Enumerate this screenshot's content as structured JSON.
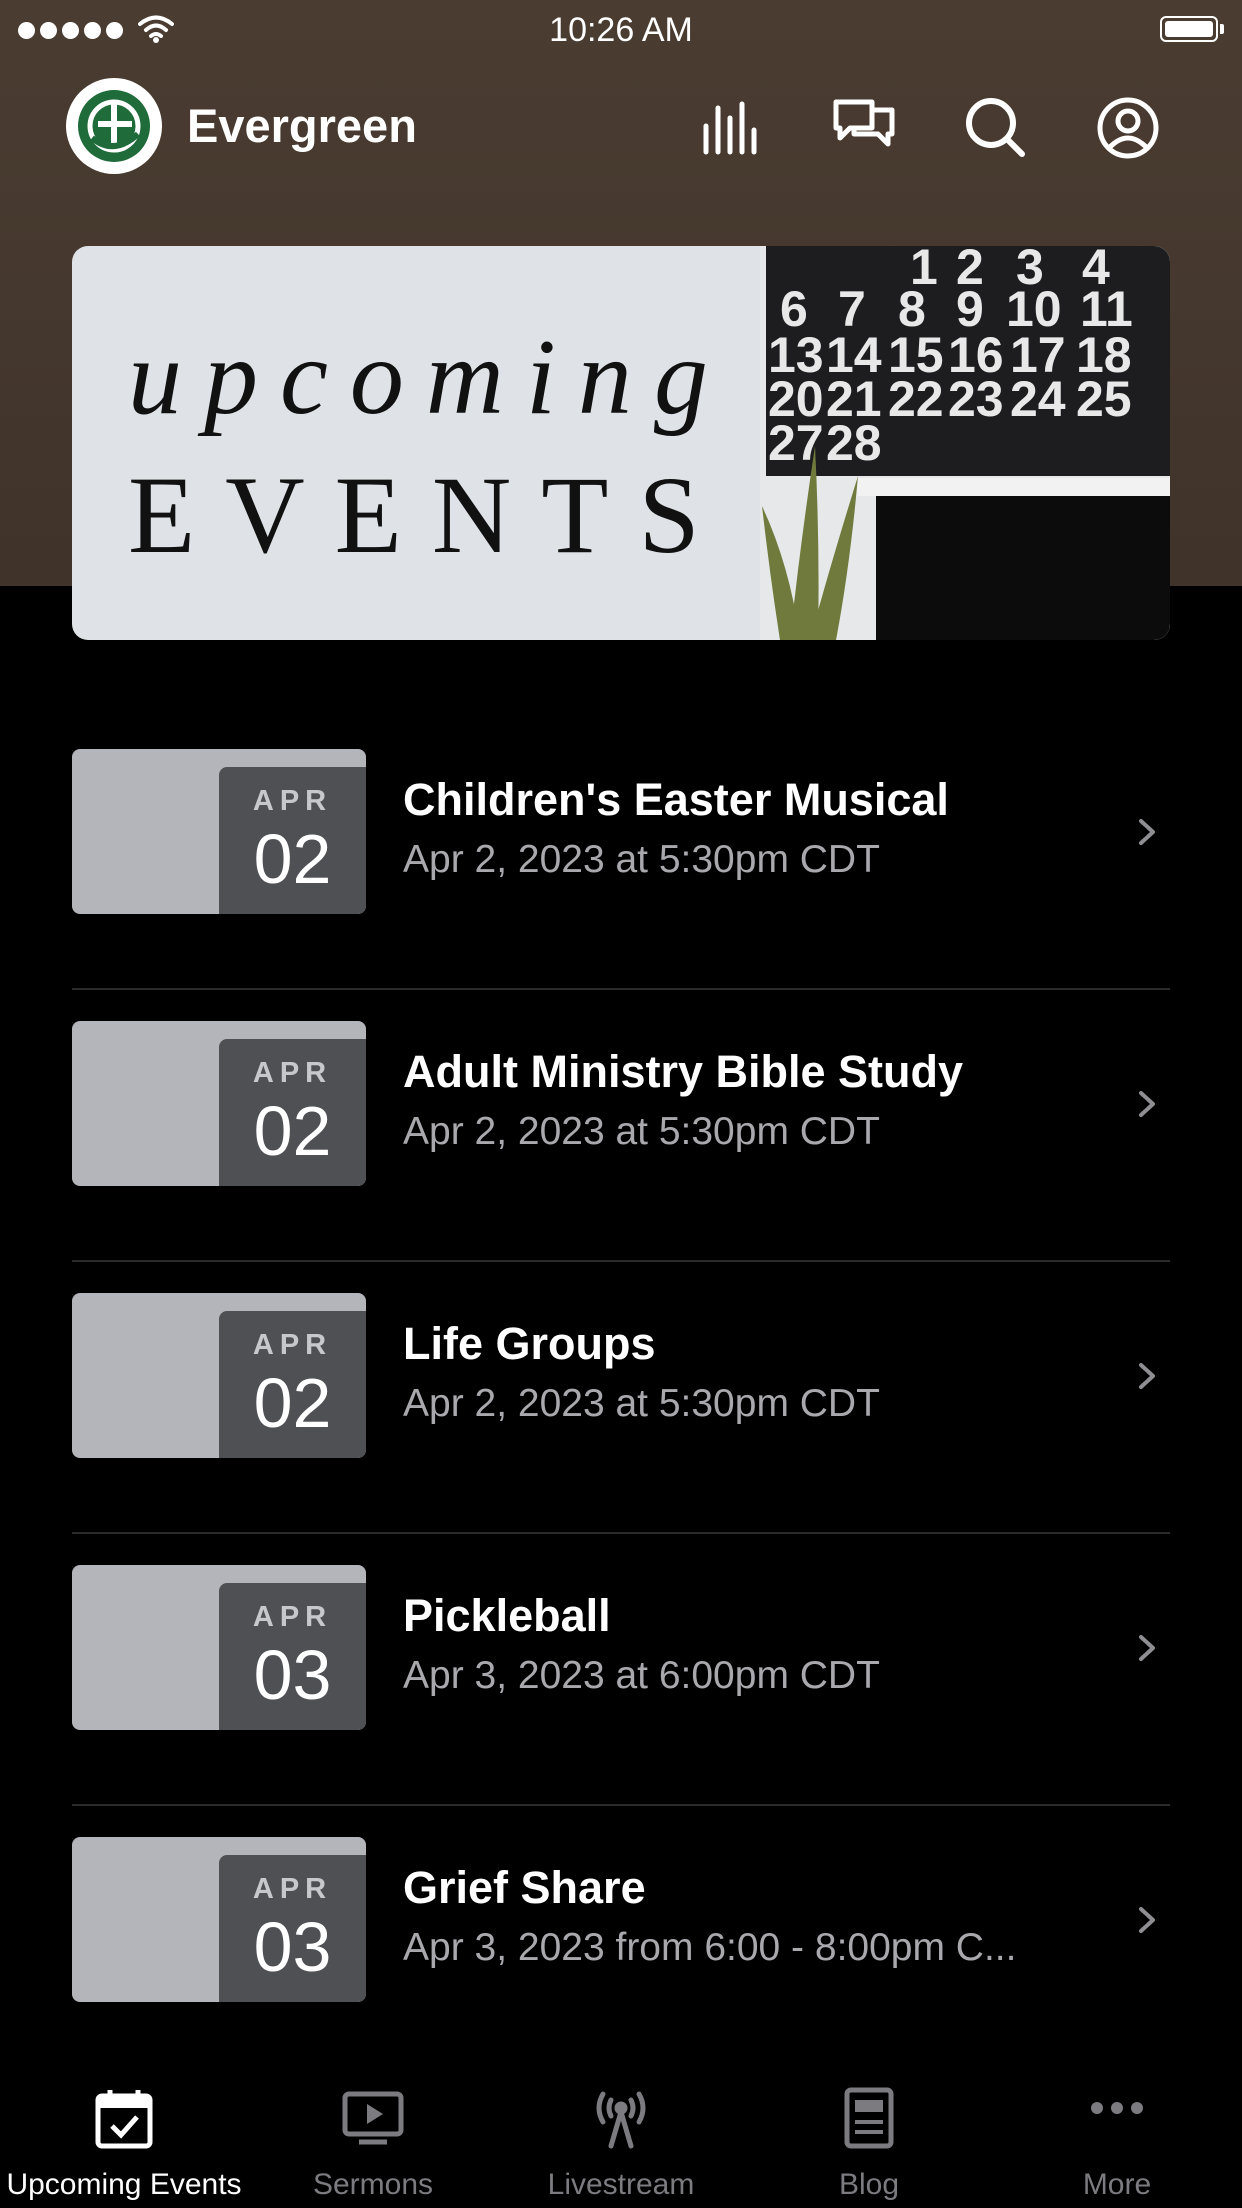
{
  "status_bar": {
    "time": "10:26 AM"
  },
  "app": {
    "title": "Evergreen"
  },
  "banner": {
    "line1": "upcoming",
    "line2": "EVENTS"
  },
  "events": [
    {
      "month": "APR",
      "day": "02",
      "title": "Children's Easter Musical",
      "when": "Apr 2, 2023 at 5:30pm CDT"
    },
    {
      "month": "APR",
      "day": "02",
      "title": "Adult Ministry Bible Study",
      "when": "Apr 2, 2023 at 5:30pm CDT"
    },
    {
      "month": "APR",
      "day": "02",
      "title": "Life Groups",
      "when": "Apr 2, 2023 at 5:30pm CDT"
    },
    {
      "month": "APR",
      "day": "03",
      "title": "Pickleball",
      "when": "Apr 3, 2023 at 6:00pm CDT"
    },
    {
      "month": "APR",
      "day": "03",
      "title": "Grief Share",
      "when": "Apr 3, 2023 from 6:00 - 8:00pm C..."
    }
  ],
  "tabs": [
    {
      "label": "Upcoming Events",
      "icon": "calendar-check-icon",
      "active": true
    },
    {
      "label": "Sermons",
      "icon": "play-screen-icon",
      "active": false
    },
    {
      "label": "Livestream",
      "icon": "broadcast-icon",
      "active": false
    },
    {
      "label": "Blog",
      "icon": "document-icon",
      "active": false
    },
    {
      "label": "More",
      "icon": "more-icon",
      "active": false
    }
  ],
  "colors": {
    "header": "#4a3c31",
    "background": "#000000",
    "logo_green": "#1f6b3a",
    "date_box": "#4f5054"
  }
}
